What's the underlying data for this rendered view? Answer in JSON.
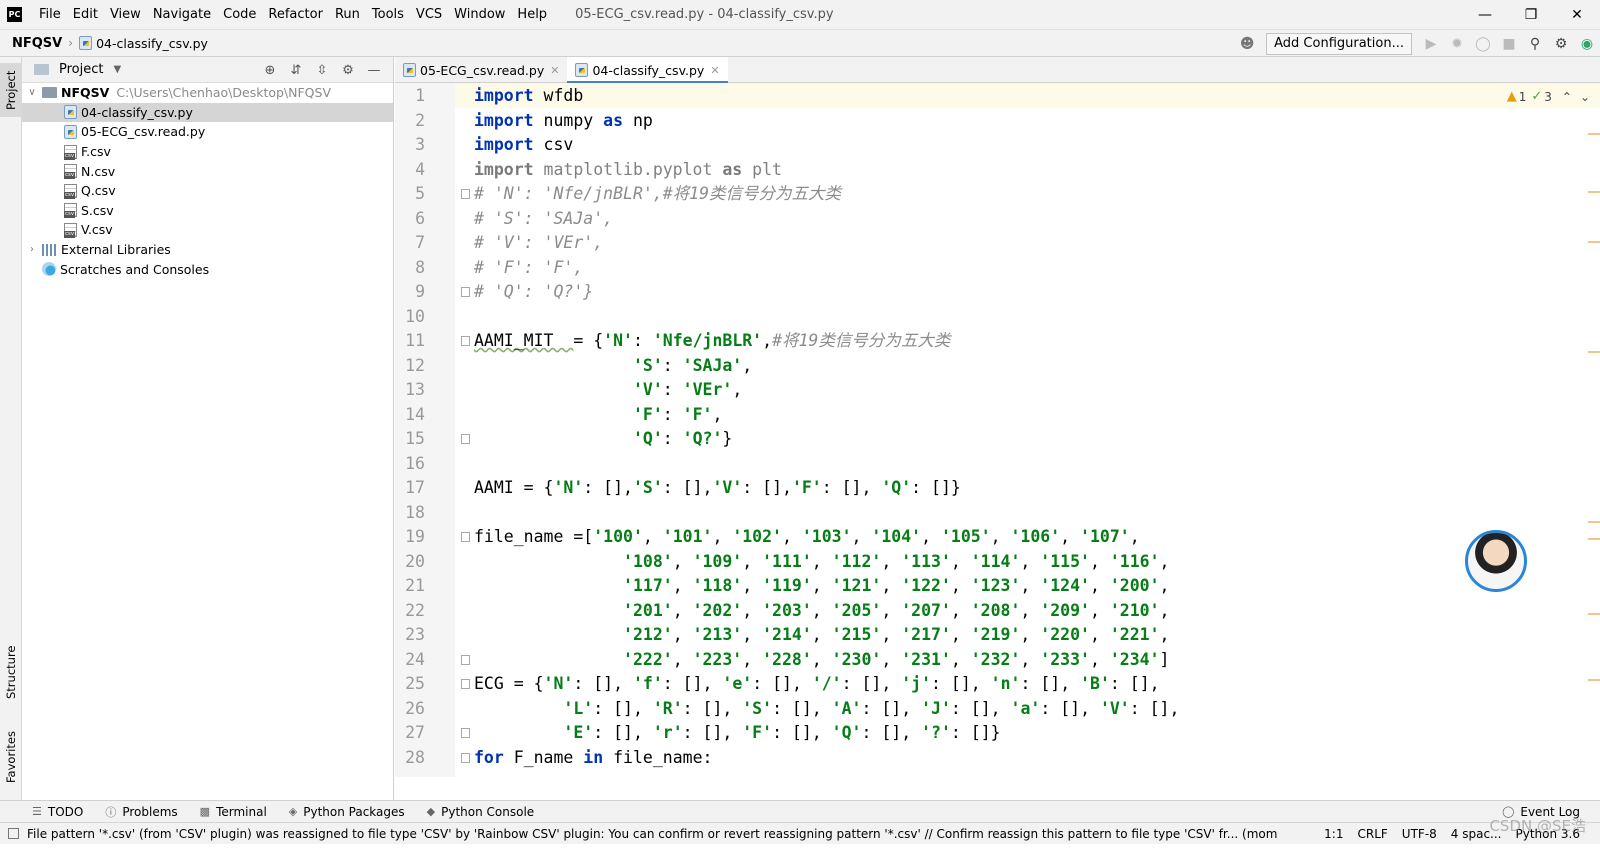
{
  "app": {
    "logo": "PC",
    "menu": [
      "File",
      "Edit",
      "View",
      "Navigate",
      "Code",
      "Refactor",
      "Run",
      "Tools",
      "VCS",
      "Window",
      "Help"
    ],
    "window_title": "05-ECG_csv.read.py - 04-classify_csv.py"
  },
  "navbar": {
    "root": "NFQSV",
    "file": "04-classify_csv.py",
    "add_config": "Add Configuration..."
  },
  "left_stripe": {
    "project": "Project",
    "structure": "Structure",
    "favorites": "Favorites"
  },
  "project_panel": {
    "title": "Project",
    "root_name": "NFQSV",
    "root_path": "C:\\Users\\Chenhao\\Desktop\\NFQSV",
    "files": [
      {
        "name": "04-classify_csv.py",
        "type": "py",
        "selected": true
      },
      {
        "name": "05-ECG_csv.read.py",
        "type": "py",
        "selected": false
      },
      {
        "name": "F.csv",
        "type": "csv",
        "selected": false
      },
      {
        "name": "N.csv",
        "type": "csv",
        "selected": false
      },
      {
        "name": "Q.csv",
        "type": "csv",
        "selected": false
      },
      {
        "name": "S.csv",
        "type": "csv",
        "selected": false
      },
      {
        "name": "V.csv",
        "type": "csv",
        "selected": false
      }
    ],
    "external_libraries": "External Libraries",
    "scratches": "Scratches and Consoles"
  },
  "tabs": [
    {
      "label": "05-ECG_csv.read.py",
      "active": false
    },
    {
      "label": "04-classify_csv.py",
      "active": true
    }
  ],
  "inspections": {
    "warnings": "1",
    "weak_warnings": "3"
  },
  "code_lines": [
    "<span class=\"kw\">import</span> wfdb",
    "<span class=\"kw\">import</span> numpy <span class=\"kw\">as</span> np",
    "<span class=\"kw\">import</span> csv",
    "<span class=\"dim\"><span class=\"kw\" style=\"color:#7a7a7a\">import</span> matplotlib.pyplot <span class=\"kw\" style=\"color:#7a7a7a\">as</span> plt</span>",
    "<span class=\"cmt\"># 'N': 'Nfe/jnBLR',#将19类信号分为五大类</span>",
    "<span class=\"cmt\"># 'S': 'SAJa',</span>",
    "<span class=\"cmt\"># 'V': 'VEr',</span>",
    "<span class=\"cmt\"># 'F': 'F',</span>",
    "<span class=\"cmt\"># 'Q': 'Q?'}</span>",
    "",
    "<span class=\"warn-u\">AAMI_MIT  </span>= {<span class=\"str\">'N'</span>: <span class=\"str\">'Nfe/jnBLR'</span>,<span class=\"cmt\">#将19类信号分为五大类</span>",
    "                <span class=\"str\">'S'</span>: <span class=\"str\">'SAJa'</span>,",
    "                <span class=\"str\">'V'</span>: <span class=\"str\">'VEr'</span>,",
    "                <span class=\"str\">'F'</span>: <span class=\"str\">'F'</span>,",
    "                <span class=\"str\">'Q'</span>: <span class=\"str\">'Q?'</span>}",
    "",
    "AAMI = {<span class=\"str\">'N'</span>: [],<span class=\"str\">'S'</span>: [],<span class=\"str\">'V'</span>: [],<span class=\"str\">'F'</span>: [], <span class=\"str\">'Q'</span>: []}",
    "",
    "file_name =[<span class=\"str\">'100'</span>, <span class=\"str\">'101'</span>, <span class=\"str\">'102'</span>, <span class=\"str\">'103'</span>, <span class=\"str\">'104'</span>, <span class=\"str\">'105'</span>, <span class=\"str\">'106'</span>, <span class=\"str\">'107'</span>,",
    "               <span class=\"str\">'108'</span>, <span class=\"str\">'109'</span>, <span class=\"str\">'111'</span>, <span class=\"str\">'112'</span>, <span class=\"str\">'113'</span>, <span class=\"str\">'114'</span>, <span class=\"str\">'115'</span>, <span class=\"str\">'116'</span>,",
    "               <span class=\"str\">'117'</span>, <span class=\"str\">'118'</span>, <span class=\"str\">'119'</span>, <span class=\"str\">'121'</span>, <span class=\"str\">'122'</span>, <span class=\"str\">'123'</span>, <span class=\"str\">'124'</span>, <span class=\"str\">'200'</span>,",
    "               <span class=\"str\">'201'</span>, <span class=\"str\">'202'</span>, <span class=\"str\">'203'</span>, <span class=\"str\">'205'</span>, <span class=\"str\">'207'</span>, <span class=\"str\">'208'</span>, <span class=\"str\">'209'</span>, <span class=\"str\">'210'</span>,",
    "               <span class=\"str\">'212'</span>, <span class=\"str\">'213'</span>, <span class=\"str\">'214'</span>, <span class=\"str\">'215'</span>, <span class=\"str\">'217'</span>, <span class=\"str\">'219'</span>, <span class=\"str\">'220'</span>, <span class=\"str\">'221'</span>,",
    "               <span class=\"str\">'222'</span>, <span class=\"str\">'223'</span>, <span class=\"str\">'228'</span>, <span class=\"str\">'230'</span>, <span class=\"str\">'231'</span>, <span class=\"str\">'232'</span>, <span class=\"str\">'233'</span>, <span class=\"str\">'234'</span>]",
    "ECG = {<span class=\"str\">'N'</span>: [], <span class=\"str\">'f'</span>: [], <span class=\"str\">'e'</span>: [], <span class=\"str\">'/'</span>: [], <span class=\"str\">'j'</span>: [], <span class=\"str\">'n'</span>: [], <span class=\"str\">'B'</span>: [],",
    "         <span class=\"str\">'L'</span>: [], <span class=\"str\">'R'</span>: [], <span class=\"str\">'S'</span>: [], <span class=\"str\">'A'</span>: [], <span class=\"str\">'J'</span>: [], <span class=\"str\">'a'</span>: [], <span class=\"str\">'V'</span>: [],",
    "         <span class=\"str\">'E'</span>: [], <span class=\"str\">'r'</span>: [], <span class=\"str\">'F'</span>: [], <span class=\"str\">'Q'</span>: [], <span class=\"str\">'?'</span>: []}",
    "<span class=\"kw\">for</span> F_name <span class=\"kw\">in</span> file_name:"
  ],
  "fold_lines": [
    1,
    5,
    9,
    11,
    15,
    19,
    24,
    25,
    27,
    28
  ],
  "tool_windows": [
    "TODO",
    "Problems",
    "Terminal",
    "Python Packages",
    "Python Console"
  ],
  "event_log": "Event Log",
  "status": {
    "message": "File pattern '*.csv' (from 'CSV' plugin) was reassigned to file type 'CSV' by 'Rainbow CSV' plugin: You can confirm or revert reassigning pattern '*.csv' // Confirm reassign this pattern to file type 'CSV' fr... (moments ago)",
    "position": "1:1",
    "line_sep": "CRLF",
    "encoding": "UTF-8",
    "indent": "4 spac...",
    "interpreter": "Python 3.6"
  },
  "watermark": "CSDN @SE浩",
  "colors": {
    "accent": "#4083c9",
    "keyword": "#0033b3",
    "string": "#067d17",
    "comment": "#8c8c8c"
  }
}
